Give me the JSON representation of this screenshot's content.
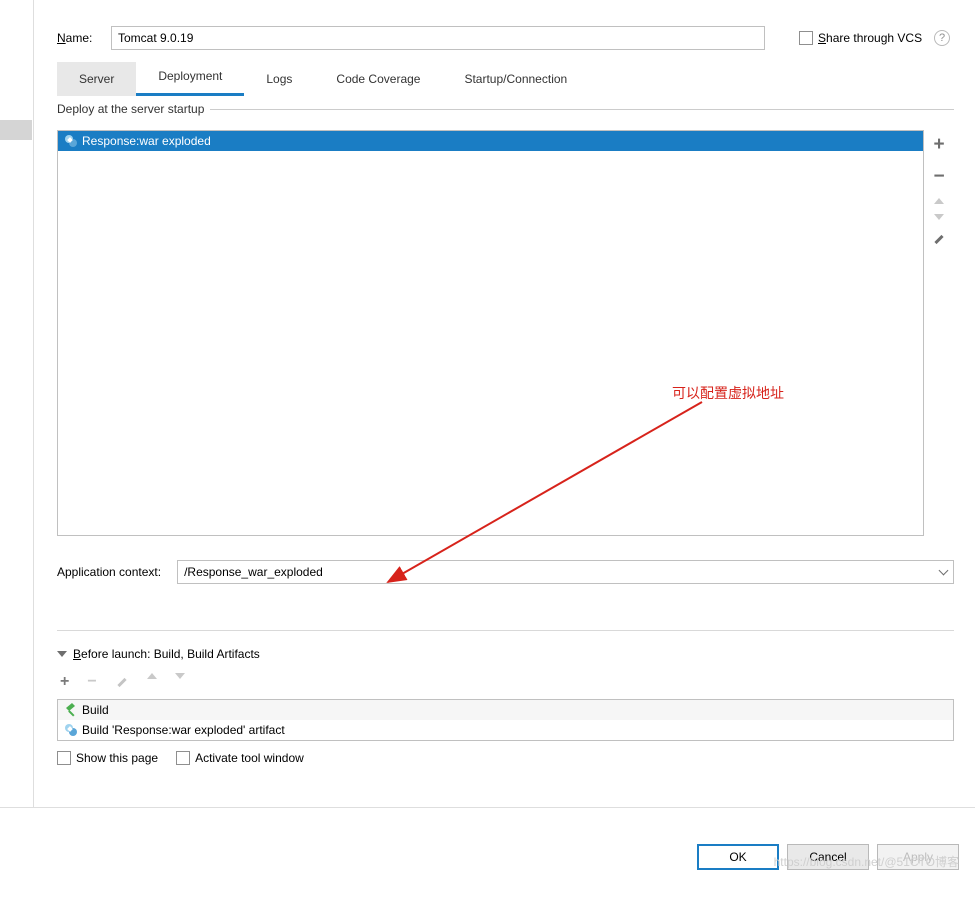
{
  "header": {
    "name_label": "Name:",
    "name_value": "Tomcat 9.0.19",
    "share_label": "Share through VCS",
    "help_symbol": "?"
  },
  "tabs": [
    "Server",
    "Deployment",
    "Logs",
    "Code Coverage",
    "Startup/Connection"
  ],
  "deploy": {
    "legend": "Deploy at the server startup",
    "items": [
      {
        "label": "Response:war exploded"
      }
    ],
    "side_buttons": {
      "add": "+",
      "remove": "−"
    },
    "app_context_label": "Application context:",
    "app_context_value": "/Response_war_exploded"
  },
  "before_launch": {
    "title": "Before launch: Build, Build Artifacts",
    "toolbar": {
      "add": "+",
      "remove": "−"
    },
    "items": [
      {
        "label": "Build"
      },
      {
        "label": "Build 'Response:war exploded' artifact"
      }
    ],
    "show_this_page": "Show this page",
    "activate_tool_window": "Activate tool window"
  },
  "footer": {
    "ok": "OK",
    "cancel": "Cancel",
    "apply": "Apply"
  },
  "annotation": {
    "text": "可以配置虚拟地址"
  },
  "watermark": "https://blog.csdn.net/@51CTO博客"
}
